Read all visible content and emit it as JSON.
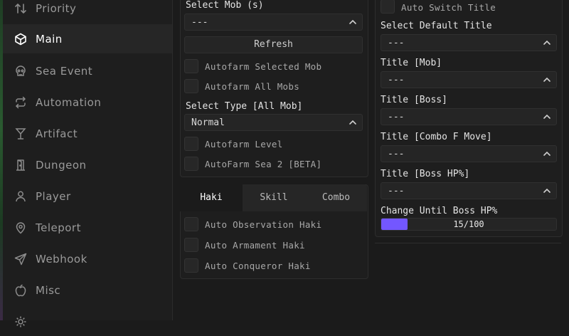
{
  "sidebar": {
    "items": [
      {
        "label": "Priority",
        "icon": "sort-arrows-icon"
      },
      {
        "label": "Main",
        "icon": "cube-icon",
        "active": true
      },
      {
        "label": "Sea Event",
        "icon": "skull-icon"
      },
      {
        "label": "Automation",
        "icon": "repeat-icon"
      },
      {
        "label": "Artifact",
        "icon": "goblet-icon"
      },
      {
        "label": "Dungeon",
        "icon": "door-icon"
      },
      {
        "label": "Player",
        "icon": "user-icon"
      },
      {
        "label": "Teleport",
        "icon": "map-pin-icon"
      },
      {
        "label": "Webhook",
        "icon": "send-icon"
      },
      {
        "label": "Misc",
        "icon": "apple-icon"
      }
    ]
  },
  "left_panel": {
    "select_mob": {
      "label": "Select Mob (s)",
      "value": "---"
    },
    "refresh_label": "Refresh",
    "autofarm_selected": "Autofarm Selected Mob",
    "autofarm_all": "Autofarm All Mobs",
    "select_type": {
      "label": "Select Type [All Mob]",
      "value": "Normal"
    },
    "autofarm_level": "Autofarm Level",
    "autofarm_sea2": "AutoFarm Sea 2 [BETA]"
  },
  "haki_panel": {
    "tabs": [
      "Haki",
      "Skill",
      "Combo"
    ],
    "auto_observation": "Auto Observation Haki",
    "auto_armament": "Auto Armament Haki",
    "auto_conqueror": "Auto Conqueror Haki"
  },
  "right_panel": {
    "auto_switch_title": "Auto Switch Title",
    "default_title": {
      "label": "Select Default Title",
      "value": "---"
    },
    "title_mob": {
      "label": "Title [Mob]",
      "value": "---"
    },
    "title_boss": {
      "label": "Title [Boss]",
      "value": "---"
    },
    "title_combo": {
      "label": "Title [Combo F Move]",
      "value": "---"
    },
    "title_boss_hp": {
      "label": "Title [Boss HP%]",
      "value": "---"
    },
    "change_until": {
      "label": "Change Until Boss HP%",
      "text": "15/100",
      "value": 15,
      "max": 100
    }
  },
  "colors": {
    "accent": "#7357ff",
    "background": "#1b1b1b",
    "panel": "#1e1e1e"
  }
}
